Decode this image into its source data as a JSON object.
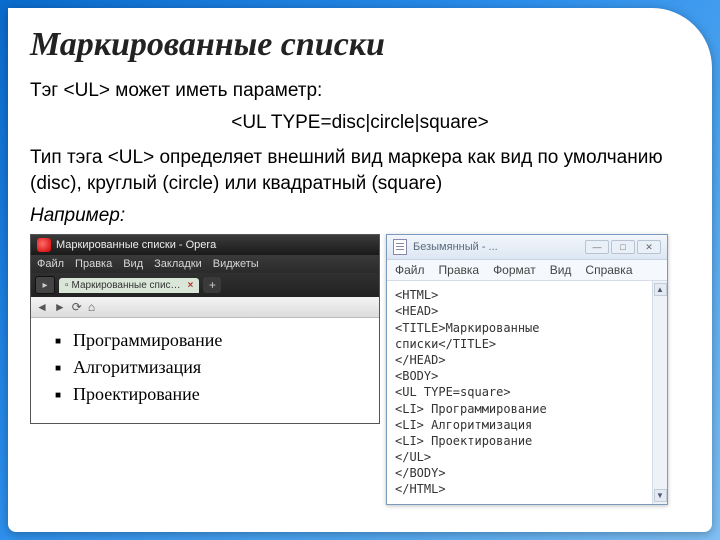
{
  "title": "Маркированные списки",
  "p1": "Тэг <UL> может иметь параметр:",
  "p2": "<UL TYPE=disc|circle|square>",
  "p3": "Тип тэга <UL> определяет внешний вид маркера как вид по умолчанию (disc), круглый (circle) или квадратный (square)",
  "p4": "Например:",
  "opera": {
    "title": "Маркированные списки - Opera",
    "menu": [
      "Файл",
      "Правка",
      "Вид",
      "Закладки",
      "Виджеты"
    ],
    "tab": "Маркированные спис…",
    "list": [
      "Программирование",
      "Алгоритмизация",
      "Проектирование"
    ]
  },
  "notepad": {
    "title": "Безымянный - ...",
    "menu": [
      "Файл",
      "Правка",
      "Формат",
      "Вид",
      "Справка"
    ],
    "code": "<HTML>\n<HEAD>\n<TITLE>Маркированные\nсписки</TITLE>\n</HEAD>\n<BODY>\n<UL TYPE=square>\n<LI> Программирование\n<LI> Алгоритмизация\n<LI> Проектирование\n</UL>\n</BODY>\n</HTML>"
  }
}
